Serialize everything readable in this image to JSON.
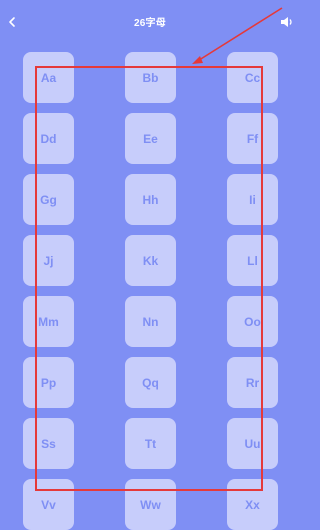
{
  "header": {
    "title": "26字母",
    "back_icon": "chevron-left-icon",
    "sound_icon": "speaker-icon"
  },
  "colors": {
    "background": "#7f8ff4",
    "tile": "#c7cdfb",
    "tile_text": "#7f8ff4",
    "annotation": "#e5393a"
  },
  "letters": [
    "Aa",
    "Bb",
    "Cc",
    "Dd",
    "Ee",
    "Ff",
    "Gg",
    "Hh",
    "Ii",
    "Jj",
    "Kk",
    "Ll",
    "Mm",
    "Nn",
    "Oo",
    "Pp",
    "Qq",
    "Rr",
    "Ss",
    "Tt",
    "Uu",
    "Vv",
    "Ww",
    "Xx"
  ]
}
